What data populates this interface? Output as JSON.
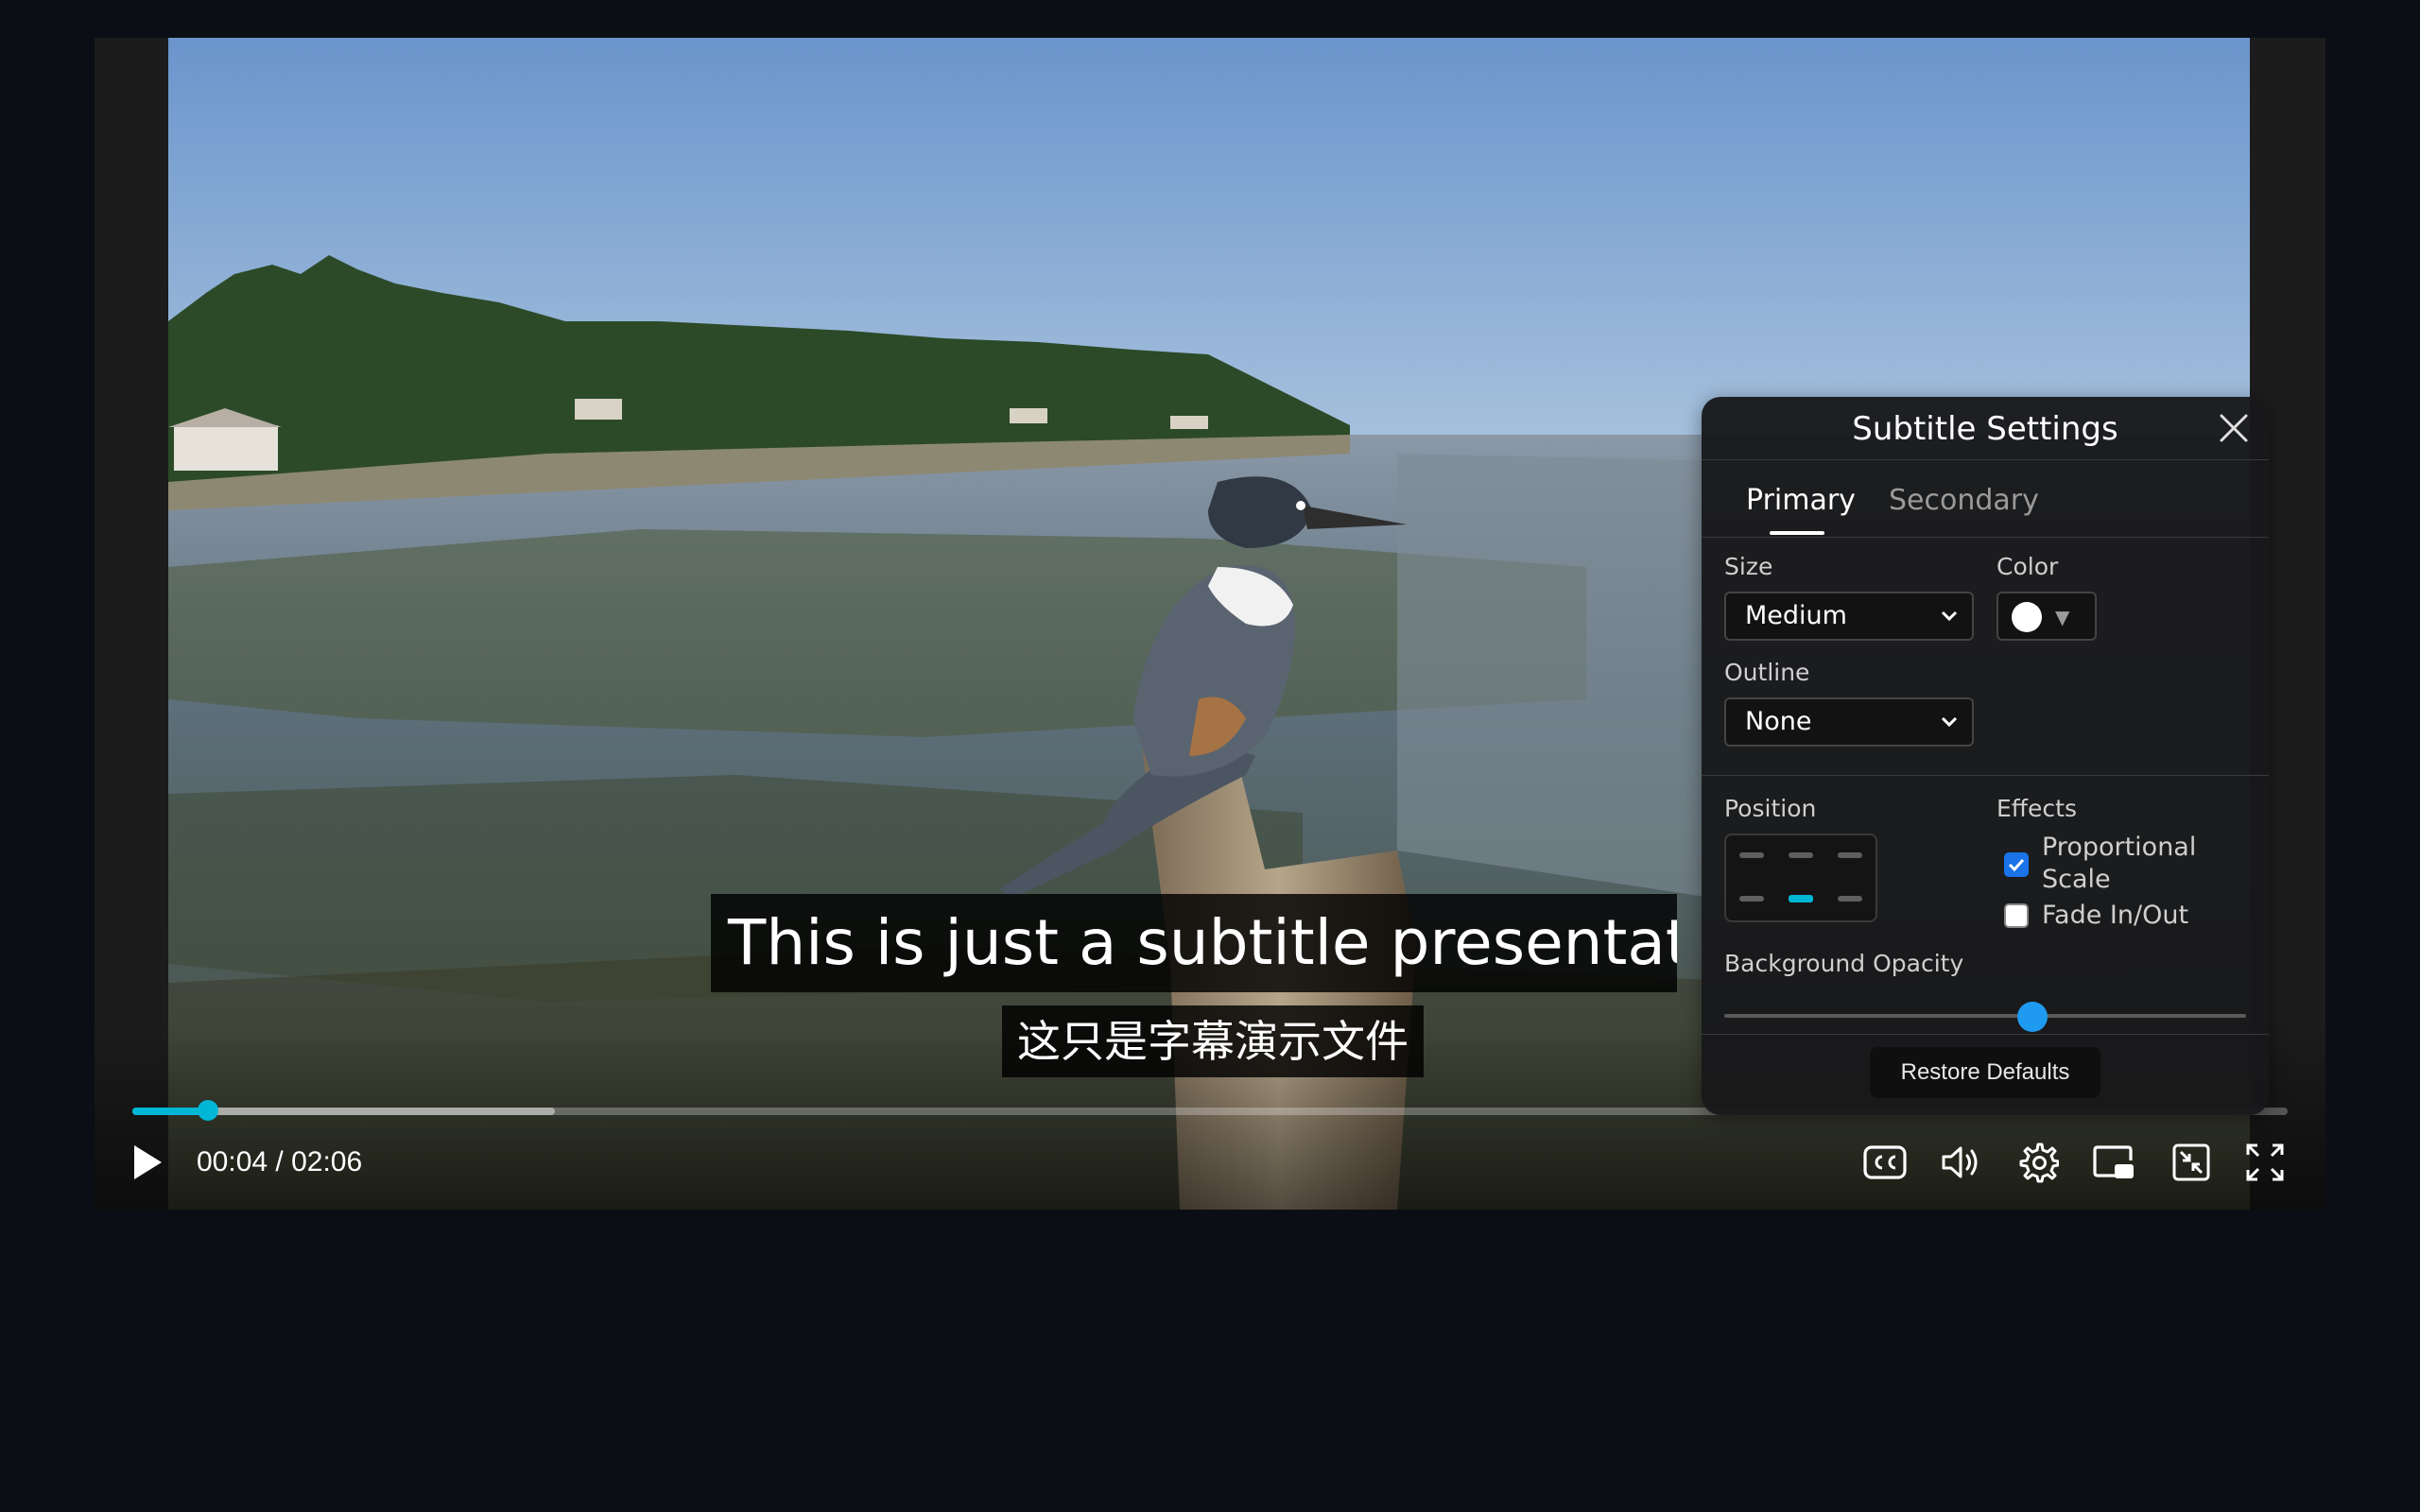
{
  "player": {
    "subtitle_primary": "This is just a subtitle presentat",
    "subtitle_secondary": "这只是字幕演示文件",
    "time_display": "00:04 / 02:06",
    "progress_played_fraction": 0.035,
    "progress_buffered_fraction": 0.196,
    "accent_color": "#00b7d6",
    "controls": {
      "left": [
        "play-icon"
      ],
      "right": [
        "closed-captions-icon",
        "volume-icon",
        "settings-gear-icon",
        "picture-in-picture-icon",
        "shrink-window-icon",
        "fullscreen-icon"
      ]
    }
  },
  "panel": {
    "title": "Subtitle Settings",
    "tabs": [
      {
        "label": "Primary",
        "active": true
      },
      {
        "label": "Secondary",
        "active": false
      }
    ],
    "size_label": "Size",
    "size_value": "Medium",
    "color_label": "Color",
    "color_value": "#ffffff",
    "outline_label": "Outline",
    "outline_value": "None",
    "position_label": "Position",
    "position_selected": "bottom-center",
    "effects_label": "Effects",
    "effects": [
      {
        "label": "Proportional Scale",
        "checked": true
      },
      {
        "label": "Fade In/Out",
        "checked": false
      }
    ],
    "opacity_label": "Background Opacity",
    "opacity_value_fraction": 0.59,
    "restore_label": "Restore Defaults"
  }
}
